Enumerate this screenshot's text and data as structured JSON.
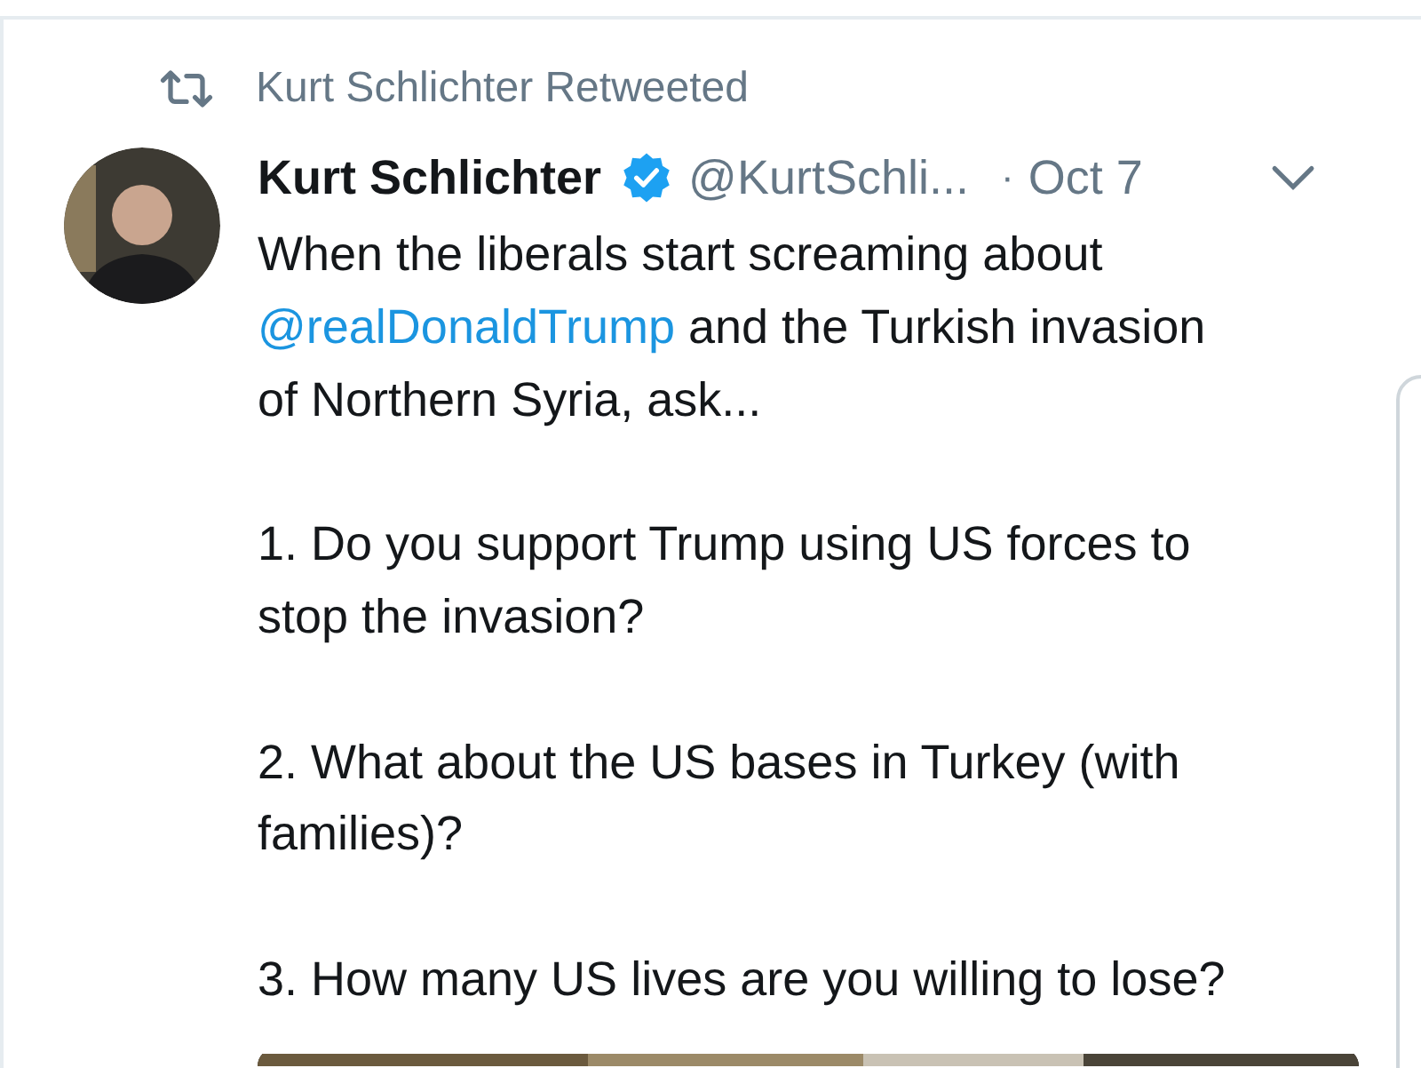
{
  "retweet_label": "Kurt Schlichter Retweeted",
  "tweet": {
    "author_name": "Kurt Schlichter",
    "verified": true,
    "handle": "@KurtSchli...",
    "separator": "·",
    "date": "Oct 7",
    "body": [
      [
        [
          {
            "kind": "text",
            "text": "When the liberals start screaming about"
          }
        ],
        [
          {
            "kind": "mention",
            "text": "@realDonaldTrump"
          },
          {
            "kind": "text",
            "text": " and the Turkish invasion"
          }
        ],
        [
          {
            "kind": "text",
            "text": "of Northern Syria, ask..."
          }
        ]
      ],
      [
        [
          {
            "kind": "text",
            "text": "1. Do you support Trump using US forces to"
          }
        ],
        [
          {
            "kind": "text",
            "text": "stop the invasion?"
          }
        ]
      ],
      [
        [
          {
            "kind": "text",
            "text": "2. What about the US bases in Turkey (with"
          }
        ],
        [
          {
            "kind": "text",
            "text": "families)?"
          }
        ]
      ],
      [
        [
          {
            "kind": "text",
            "text": "3. How many US lives are you willing to lose?"
          }
        ]
      ]
    ],
    "media": {
      "kind": "picture"
    }
  }
}
